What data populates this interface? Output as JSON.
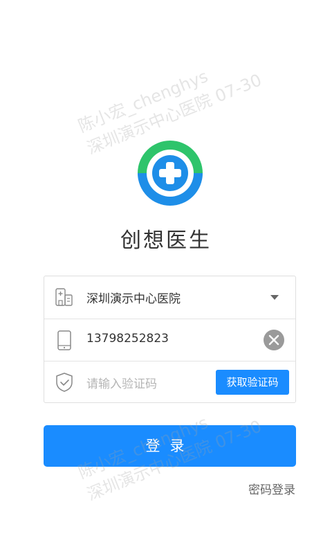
{
  "watermark": {
    "line1": "陈小宏_chenghys",
    "line2": "深圳演示中心医院  07-30"
  },
  "app": {
    "title": "创想医生"
  },
  "form": {
    "hospital": {
      "value": "深圳演示中心医院",
      "icon": "hospital-icon"
    },
    "phone": {
      "value": "13798252823",
      "icon": "phone-icon"
    },
    "code": {
      "placeholder": "请输入验证码",
      "icon": "shield-check-icon",
      "button_label": "获取验证码"
    }
  },
  "actions": {
    "login_label": "登录",
    "password_login_label": "密码登录"
  },
  "colors": {
    "accent": "#1a8cff",
    "logo_green": "#2ec46b",
    "logo_blue": "#1e8ee8"
  }
}
